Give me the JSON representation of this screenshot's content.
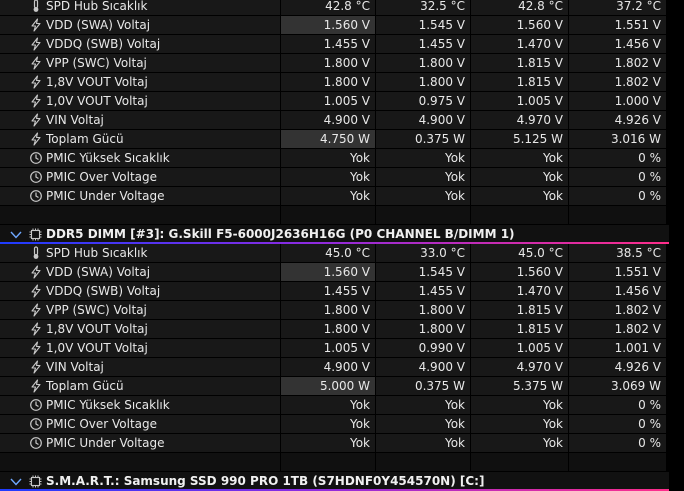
{
  "section1": {
    "rows": [
      {
        "icon": "thermometer-icon",
        "label": "SPD Hub Sıcaklık",
        "v": [
          "42.8 °C",
          "32.5 °C",
          "42.8 °C",
          "37.2 °C"
        ]
      },
      {
        "icon": "bolt-icon",
        "label": "VDD (SWA) Voltaj",
        "v": [
          "1.560 V",
          "1.545 V",
          "1.560 V",
          "1.551 V"
        ]
      },
      {
        "icon": "bolt-icon",
        "label": "VDDQ (SWB) Voltaj",
        "v": [
          "1.455 V",
          "1.455 V",
          "1.470 V",
          "1.456 V"
        ]
      },
      {
        "icon": "bolt-icon",
        "label": "VPP (SWC) Voltaj",
        "v": [
          "1.800 V",
          "1.800 V",
          "1.815 V",
          "1.802 V"
        ]
      },
      {
        "icon": "bolt-icon",
        "label": "1,8V VOUT Voltaj",
        "v": [
          "1.800 V",
          "1.800 V",
          "1.815 V",
          "1.802 V"
        ]
      },
      {
        "icon": "bolt-icon",
        "label": "1,0V VOUT Voltaj",
        "v": [
          "1.005 V",
          "0.975 V",
          "1.005 V",
          "1.000 V"
        ]
      },
      {
        "icon": "bolt-icon",
        "label": "VIN Voltaj",
        "v": [
          "4.900 V",
          "4.900 V",
          "4.970 V",
          "4.926 V"
        ]
      },
      {
        "icon": "bolt-icon",
        "label": "Toplam Gücü",
        "v": [
          "4.750 W",
          "0.375 W",
          "5.125 W",
          "3.016 W"
        ]
      },
      {
        "icon": "clock-icon",
        "label": "PMIC Yüksek Sıcaklık",
        "v": [
          "Yok",
          "Yok",
          "Yok",
          "0 %"
        ]
      },
      {
        "icon": "clock-icon",
        "label": "PMIC Over Voltage",
        "v": [
          "Yok",
          "Yok",
          "Yok",
          "0 %"
        ]
      },
      {
        "icon": "clock-icon",
        "label": "PMIC Under Voltage",
        "v": [
          "Yok",
          "Yok",
          "Yok",
          "0 %"
        ]
      }
    ]
  },
  "section2": {
    "title": "DDR5 DIMM [#3]: G.Skill F5-6000J2636H16G (P0 CHANNEL B/DIMM 1)",
    "rows": [
      {
        "icon": "thermometer-icon",
        "label": "SPD Hub Sıcaklık",
        "v": [
          "45.0 °C",
          "33.0 °C",
          "45.0 °C",
          "38.5 °C"
        ]
      },
      {
        "icon": "bolt-icon",
        "label": "VDD (SWA) Voltaj",
        "v": [
          "1.560 V",
          "1.545 V",
          "1.560 V",
          "1.551 V"
        ]
      },
      {
        "icon": "bolt-icon",
        "label": "VDDQ (SWB) Voltaj",
        "v": [
          "1.455 V",
          "1.455 V",
          "1.470 V",
          "1.456 V"
        ]
      },
      {
        "icon": "bolt-icon",
        "label": "VPP (SWC) Voltaj",
        "v": [
          "1.800 V",
          "1.800 V",
          "1.815 V",
          "1.802 V"
        ]
      },
      {
        "icon": "bolt-icon",
        "label": "1,8V VOUT Voltaj",
        "v": [
          "1.800 V",
          "1.800 V",
          "1.815 V",
          "1.802 V"
        ]
      },
      {
        "icon": "bolt-icon",
        "label": "1,0V VOUT Voltaj",
        "v": [
          "1.005 V",
          "0.990 V",
          "1.005 V",
          "1.001 V"
        ]
      },
      {
        "icon": "bolt-icon",
        "label": "VIN Voltaj",
        "v": [
          "4.900 V",
          "4.900 V",
          "4.970 V",
          "4.926 V"
        ]
      },
      {
        "icon": "bolt-icon",
        "label": "Toplam Gücü",
        "v": [
          "5.000 W",
          "0.375 W",
          "5.375 W",
          "3.069 W"
        ]
      },
      {
        "icon": "clock-icon",
        "label": "PMIC Yüksek Sıcaklık",
        "v": [
          "Yok",
          "Yok",
          "Yok",
          "0 %"
        ]
      },
      {
        "icon": "clock-icon",
        "label": "PMIC Over Voltage",
        "v": [
          "Yok",
          "Yok",
          "Yok",
          "0 %"
        ]
      },
      {
        "icon": "clock-icon",
        "label": "PMIC Under Voltage",
        "v": [
          "Yok",
          "Yok",
          "Yok",
          "0 %"
        ]
      }
    ]
  },
  "section3": {
    "title": "S.M.A.R.T.: Samsung SSD 990 PRO 1TB (S7HDNF0Y454570N) [C:]"
  },
  "colors": {
    "highlight": "#333333",
    "cell": "#181818",
    "icon": "#c8c8c8",
    "gradient": [
      "#1e3cff",
      "#8a2be2",
      "#ff2d8a"
    ]
  }
}
